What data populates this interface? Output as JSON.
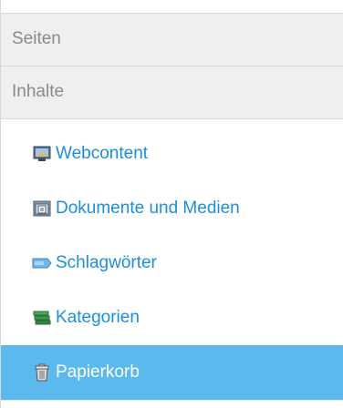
{
  "sections": {
    "pages_label": "Seiten",
    "content_label": "Inhalte"
  },
  "items": [
    {
      "label": "Webcontent",
      "icon": "web-content-icon"
    },
    {
      "label": "Dokumente und Medien",
      "icon": "documents-media-icon"
    },
    {
      "label": "Schlagwörter",
      "icon": "tags-icon"
    },
    {
      "label": "Kategorien",
      "icon": "categories-icon"
    },
    {
      "label": "Papierkorb",
      "icon": "trash-icon",
      "selected": true
    }
  ],
  "colors": {
    "link": "#1e8ed8",
    "active_bg": "#5bb9ee",
    "header_bg": "#efefef"
  }
}
